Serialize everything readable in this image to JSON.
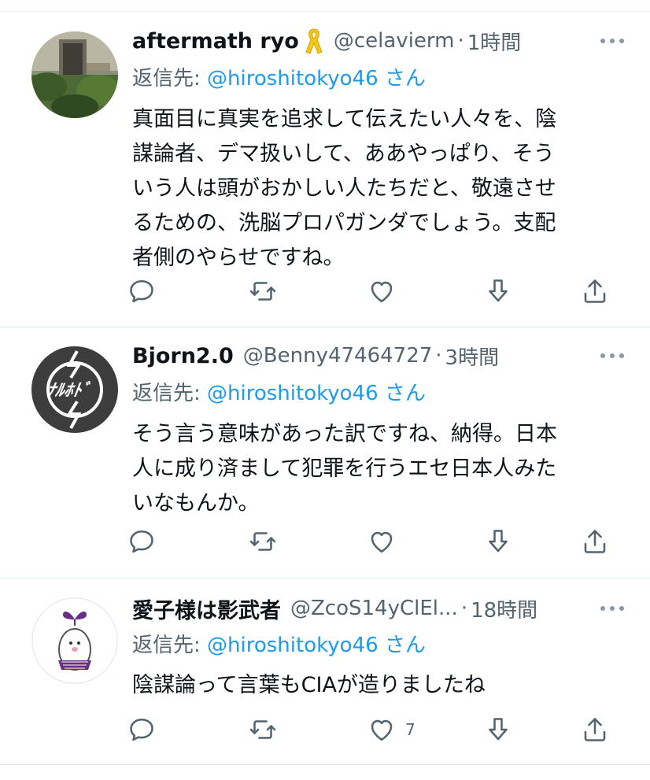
{
  "reply_prefix": "返信先:",
  "reply_suffix": "さん",
  "colors": {
    "accent": "#1d9bf0",
    "muted": "#536471",
    "ribbon": "#f5c518"
  },
  "tweets": [
    {
      "name": "aftermath ryo",
      "badge_icon": "yellow-ribbon-icon",
      "handle": "@celavierm",
      "dot": "·",
      "time": "1時間",
      "reply_to": "@hiroshitokyo46",
      "lines": [
        "真面目に真実を追求して伝えたい人々を、陰",
        "謀論者、デマ扱いして、ああやっぱり、そう",
        "いう人は頭がおかしい人たちだと、敬遠させ",
        "るための、洗脳プロパガンダでしょう。支配",
        "者側のやらせですね。"
      ],
      "like_count": ""
    },
    {
      "name": "Bjorn2.0",
      "handle": "@Benny47464727",
      "dot": "·",
      "time": "3時間",
      "reply_to": "@hiroshitokyo46",
      "lines": [
        "そう言う意味があった訳ですね、納得。日本",
        "人に成り済まして犯罪を行うエセ日本人みた",
        "いなもんか。"
      ],
      "like_count": ""
    },
    {
      "name": "愛子様は影武者",
      "handle": "@ZcoS14yClEl...",
      "dot": "·",
      "time": "18時間",
      "reply_to": "@hiroshitokyo46",
      "lines": [
        "陰謀論って言葉もCIAが造りましたね"
      ],
      "like_count": "7"
    }
  ]
}
